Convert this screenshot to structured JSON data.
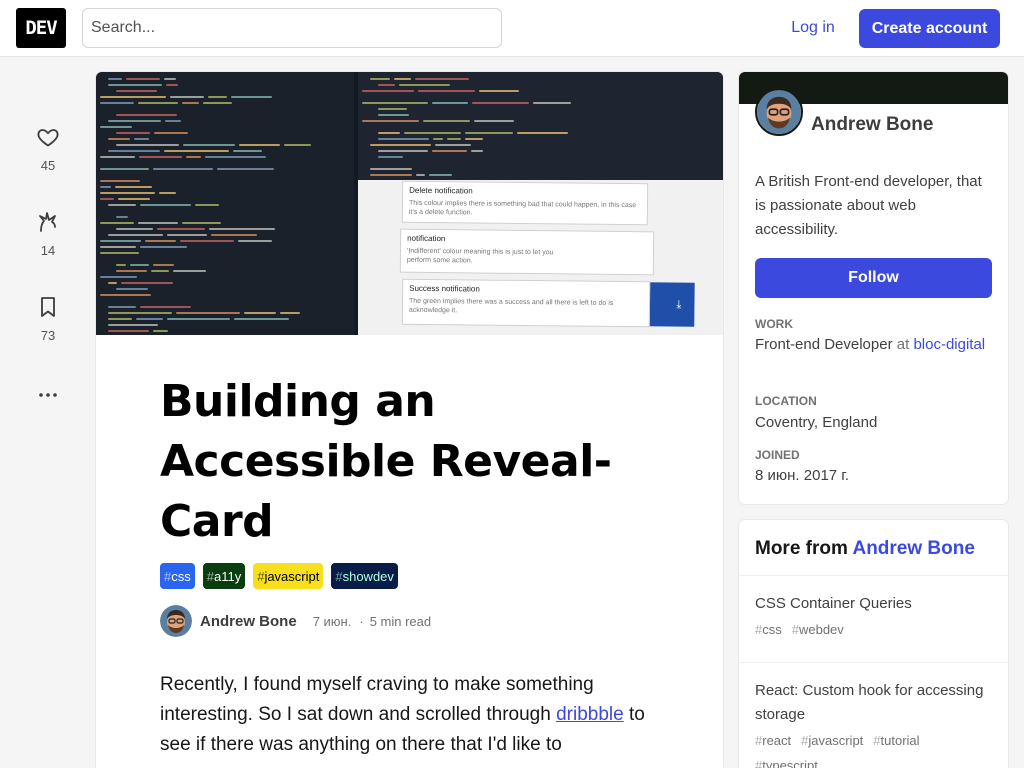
{
  "header": {
    "logo": "DEV",
    "search_placeholder": "Search...",
    "login_label": "Log in",
    "create_account_label": "Create account"
  },
  "reactions": [
    {
      "icon": "heart-icon",
      "count": "45"
    },
    {
      "icon": "unicorn-icon",
      "count": "14"
    },
    {
      "icon": "bookmark-icon",
      "count": "73"
    }
  ],
  "article": {
    "title": "Building an Accessible Reveal-Card",
    "tags": [
      {
        "name": "css",
        "bg": "#2965f1",
        "fg": "#ffffff"
      },
      {
        "name": "a11y",
        "bg": "#0a3d10",
        "fg": "#ffffff"
      },
      {
        "name": "javascript",
        "bg": "#f7df1e",
        "fg": "#000000"
      },
      {
        "name": "showdev",
        "bg": "#091b47",
        "fg": "#b2ffe1"
      }
    ],
    "author": "Andrew Bone",
    "date": "7 июн.",
    "read_time": "5 min read",
    "body_before_link": "Recently, I found myself craving to make something interesting. So I sat down and scrolled through ",
    "body_link": "dribbble",
    "body_after_link": " to see if there was anything on there that I'd like to"
  },
  "cover_demo": {
    "card1_title": "Delete notification",
    "card1_desc": "This colour implies there is something bad that could happen, in this case it's a delete function.",
    "card2_title": "notification",
    "card2_desc": "'Indifferent' colour meaning this is just to let you perform some action.",
    "card3_title": "Success notification",
    "card3_desc": "The green implies there was a success and all there is left to do is acknowledge it."
  },
  "profile": {
    "name": "Andrew Bone",
    "bio": "A British Front-end developer, that is passionate about web accessibility.",
    "follow_label": "Follow",
    "work_label": "WORK",
    "work_role": "Front-end Developer",
    "work_at": "at",
    "work_company": "bloc-digital",
    "location_label": "LOCATION",
    "location": "Coventry, England",
    "joined_label": "JOINED",
    "joined": "8 июн. 2017 г."
  },
  "more_from": {
    "prefix": "More from",
    "author": "Andrew Bone",
    "items": [
      {
        "title": "CSS Container Queries",
        "tags": [
          "css",
          "webdev"
        ]
      },
      {
        "title": "React: Custom hook for accessing storage",
        "tags": [
          "react",
          "javascript",
          "tutorial",
          "typescript"
        ]
      }
    ]
  },
  "colors": {
    "accent": "#3b49df",
    "profile_brand": "#121a13"
  }
}
